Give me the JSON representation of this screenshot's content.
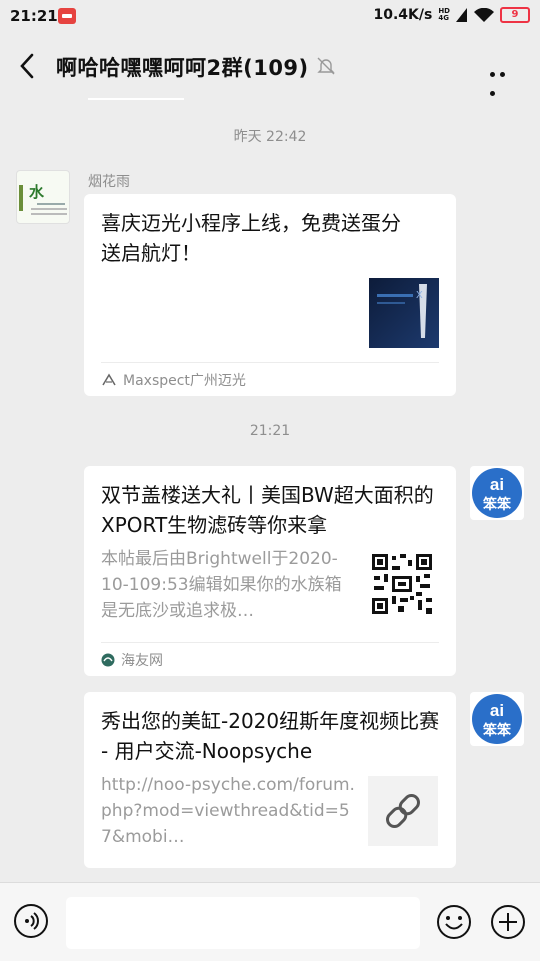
{
  "status": {
    "time": "21:21",
    "speed": "10.4K/s",
    "hd": "HD",
    "signal": "4G",
    "battery": "9"
  },
  "header": {
    "title": "啊哈哈嘿嘿呵呵2群(109)"
  },
  "timestamps": [
    "昨天 22:42",
    "21:21"
  ],
  "messages": [
    {
      "sender": "烟花雨",
      "avatar_text": "水",
      "title": "喜庆迈光小程序上线，免费送蛋分送启航灯！",
      "source": "Maxspect广州迈光"
    },
    {
      "title": "双节盖楼送大礼丨美国BW超大面积的XPORT生物滤砖等你来拿",
      "desc": "本帖最后由Brightwell于2020-10-109:53编辑如果你的水族箱是无底沙或追求极…",
      "source": "海友网"
    },
    {
      "title": "秀出您的美缸-2020纽斯年度视频比赛 - 用户交流-Noopsyche",
      "desc": "http://noo-psyche.com/forum.php?mod=viewthread&tid=57&mobi…"
    }
  ],
  "self_avatar": {
    "text_top": "ai",
    "text_bottom": "笨笨"
  },
  "composer": {
    "placeholder": ""
  },
  "colors": {
    "bg": "#ededed",
    "card": "#ffffff",
    "accent": "#2a6fc9"
  }
}
